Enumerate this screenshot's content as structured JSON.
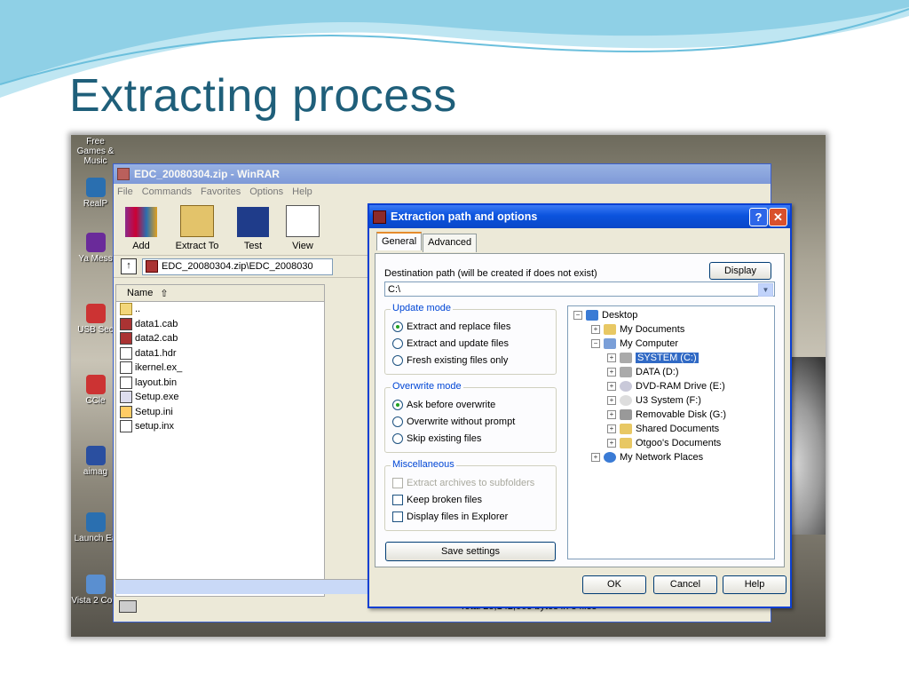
{
  "slide": {
    "title": "Extracting process"
  },
  "desktop": {
    "icons": [
      "Free Games & Music",
      "RealP",
      "Ya Mess",
      "USB Sec",
      "CCle",
      "aimag",
      "Launch Ea",
      "Vista 2 Com"
    ]
  },
  "winrar": {
    "title": "EDC_20080304.zip - WinRAR",
    "menu": [
      "File",
      "Commands",
      "Favorites",
      "Options",
      "Help"
    ],
    "toolbar": [
      "Add",
      "Extract To",
      "Test",
      "View"
    ],
    "address": "EDC_20080304.zip\\EDC_2008030",
    "column_name": "Name",
    "files": [
      "..",
      "data1.cab",
      "data2.cab",
      "data1.hdr",
      "ikernel.ex_",
      "layout.bin",
      "Setup.exe",
      "Setup.ini",
      "setup.inx"
    ],
    "status_total": "Total 28,142,663 bytes in 8 files"
  },
  "dialog": {
    "title": "Extraction path and options",
    "tabs": [
      "General",
      "Advanced"
    ],
    "dest_label": "Destination path (will be created if does not exist)",
    "display_button": "Display",
    "dest_value": "C:\\",
    "update_mode": {
      "title": "Update mode",
      "options": [
        "Extract and replace files",
        "Extract and update files",
        "Fresh existing files only"
      ],
      "selected": 0
    },
    "overwrite_mode": {
      "title": "Overwrite mode",
      "options": [
        "Ask before overwrite",
        "Overwrite without prompt",
        "Skip existing files"
      ],
      "selected": 0
    },
    "misc": {
      "title": "Miscellaneous",
      "options": [
        "Extract archives to subfolders",
        "Keep broken files",
        "Display files in Explorer"
      ]
    },
    "save_button": "Save settings",
    "tree": [
      "Desktop",
      "My Documents",
      "My Computer",
      "SYSTEM (C:)",
      "DATA (D:)",
      "DVD-RAM Drive (E:)",
      "U3 System (F:)",
      "Removable Disk (G:)",
      "Shared Documents",
      "Otgoo's Documents",
      "My Network Places"
    ],
    "ok": "OK",
    "cancel": "Cancel",
    "help": "Help"
  }
}
